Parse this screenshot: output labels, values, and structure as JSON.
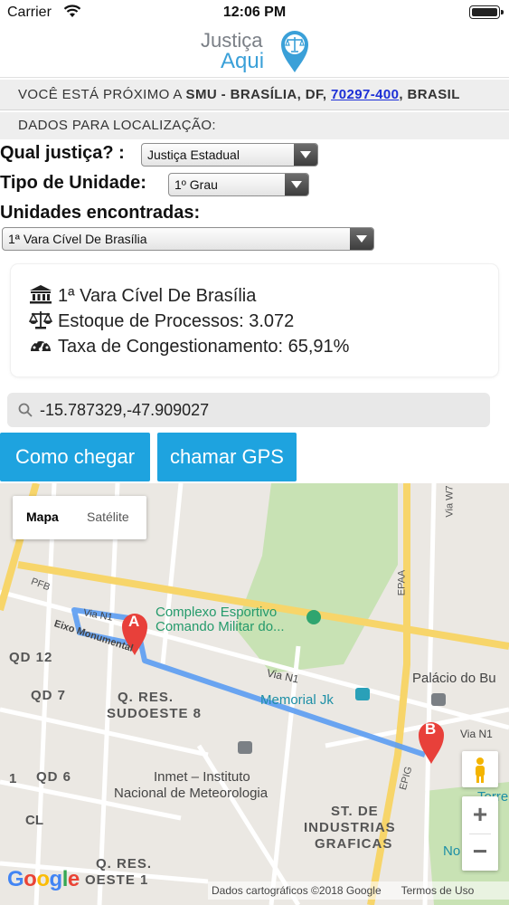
{
  "status_bar": {
    "carrier": "Carrier",
    "time": "12:06 PM"
  },
  "header": {
    "logo_line1": "Justiça",
    "logo_line2": "Aqui"
  },
  "location": {
    "prefix": "VOCÊ ESTÁ PRÓXIMO A ",
    "place": "SMU - BRASÍLIA, DF, ",
    "zip": "70297-400",
    "suffix": ", BRASIL"
  },
  "dados_label": "DADOS PARA LOCALIZAÇÃO:",
  "form": {
    "justica_label": "Qual justiça? :",
    "justica_value": "Justiça Estadual",
    "tipo_label": "Tipo de Unidade:",
    "tipo_value": "1º Grau",
    "unidades_label": "Unidades encontradas:",
    "unidades_value": "1ª Vara Cível De Brasília"
  },
  "info": {
    "name": "1ª Vara Cível De Brasília",
    "estoque": "Estoque de Processos: 3.072",
    "taxa": "Taxa de Congestionamento: 65,91%"
  },
  "search": {
    "value": "-15.787329,-47.909027"
  },
  "buttons": {
    "como_chegar": "Como chegar",
    "chamar_gps": "chamar GPS"
  },
  "map": {
    "type_map": "Mapa",
    "type_satellite": "Satélite",
    "zoom_in": "+",
    "zoom_out": "−",
    "google": [
      "G",
      "o",
      "o",
      "g",
      "l",
      "e"
    ],
    "attribution": "Dados cartográficos ©2018 Google",
    "terms": "Termos de Uso",
    "marker_a": "A",
    "marker_b": "B",
    "labels": {
      "complexo1": "Complexo Esportivo",
      "complexo2": "Comando Militar do...",
      "via_n1_a": "Via N1",
      "via_n1_b": "Via N1",
      "via_n1_c": "Via N1",
      "eixo": "Eixo Monumental",
      "pfb": "PFB",
      "qd12": "QD 12",
      "qd7": "QD 7",
      "qd6": "QD 6",
      "one": "1",
      "cl": "CL",
      "qres1": "Q. RES.",
      "qres2": "SUDOESTE 8",
      "qres3": "Q. RES.",
      "qres4": "OESTE 1",
      "memorial": "Memorial Jk",
      "palacio": "Palácio do Bu",
      "inmet1": "Inmet – Instituto",
      "inmet2": "Nacional de Meteorologia",
      "st1": "ST. DE",
      "st2": "INDUSTRIAS",
      "st3": "GRAFICAS",
      "epaa": "EPAA",
      "epig": "EPIG",
      "torre": "Torre",
      "no": "No",
      "via_w7": "Via W7"
    },
    "colors": {
      "route": "#5b9cf2",
      "marker": "#e8403a",
      "park": "#c8e2b4",
      "highway": "#f7d56a",
      "poi_label": "#249a6b",
      "memorial_label": "#1d8fa6"
    }
  }
}
